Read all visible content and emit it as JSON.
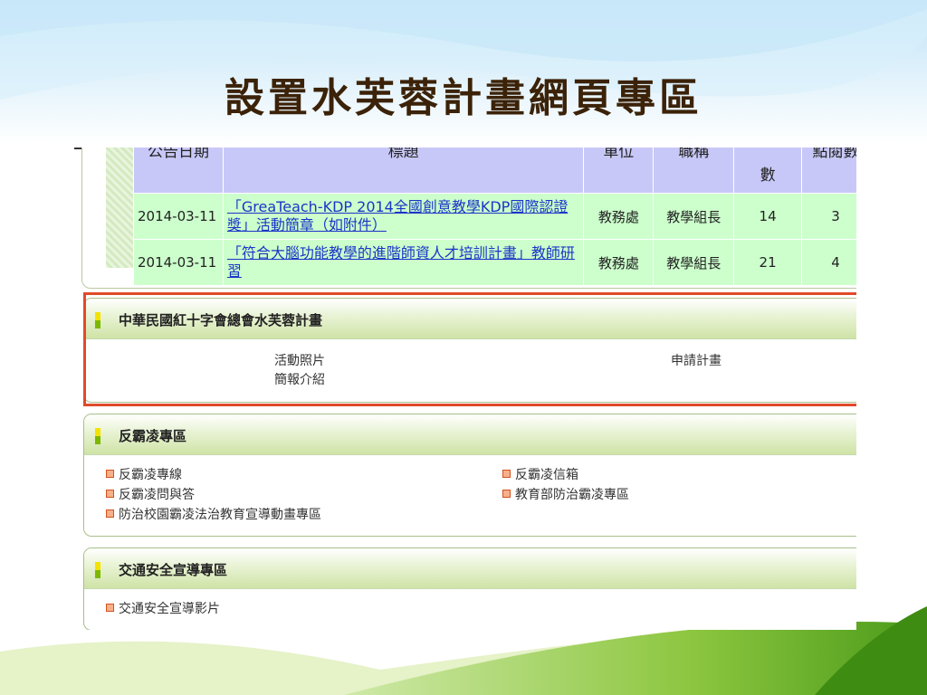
{
  "slide": {
    "title": "設置水芙蓉計畫網頁專區"
  },
  "announcements": {
    "headers": {
      "date": "公告日期",
      "title": "標題",
      "unit": "單位",
      "job": "職稱",
      "count": "數",
      "clicks": "點閱數"
    },
    "rows": [
      {
        "date": "2014-03-11",
        "title": "「GreaTeach-KDP 2014全國創意教學KDP國際認證獎」活動簡章（如附件）",
        "unit": "教務處",
        "job": "教學組長",
        "count": "14",
        "clicks": "3"
      },
      {
        "date": "2014-03-11",
        "title": "「符合大腦功能教學的進階師資人才培訓計畫」教師研習",
        "unit": "教務處",
        "job": "教學組長",
        "count": "21",
        "clicks": "4"
      }
    ]
  },
  "panels": {
    "redcross": {
      "title": "中華民國紅十字會總會水芙蓉計畫",
      "links": [
        "活動照片",
        "簡報介紹",
        "申請計畫"
      ]
    },
    "antibully": {
      "title": "反霸凌專區",
      "links": [
        "反霸凌專線",
        "反霸凌問與答",
        "防治校園霸凌法治教育宣導動畫專區",
        "反霸凌信箱",
        "教育部防治霸凌專區"
      ]
    },
    "traffic": {
      "title": "交通安全宣導專區",
      "links": [
        "交通安全宣導影片"
      ]
    }
  },
  "colors": {
    "highlight": "#e14a2a",
    "title": "#3b2208",
    "link": "#1a35c8"
  }
}
